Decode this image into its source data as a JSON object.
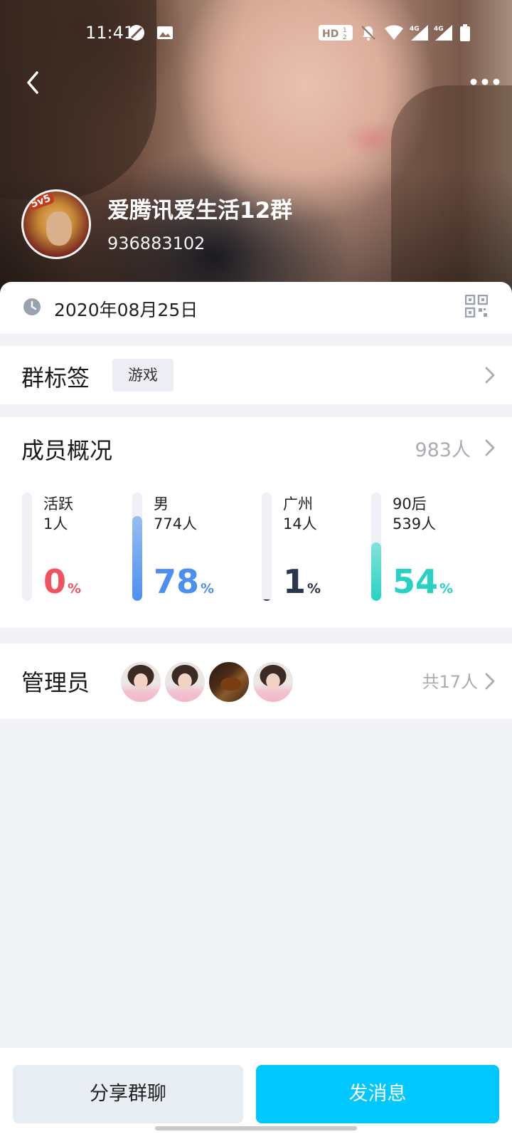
{
  "status_bar": {
    "time": "11:41",
    "icons": [
      "do-not-disturb-icon",
      "image-icon",
      "hd-voice-icon",
      "notifications-off-icon",
      "wifi-icon",
      "signal-4g-icon",
      "signal-4g-icon",
      "battery-icon"
    ],
    "network_label": "4G"
  },
  "nav": {
    "back_icon": "chevron-left-icon",
    "more_icon": "more-horizontal-icon"
  },
  "group": {
    "name": "爱腾讯爱生活12群",
    "id": "936883102",
    "avatar_badge": "5v5"
  },
  "info": {
    "created_date": "2020年08月25日"
  },
  "tags": {
    "title": "群标签",
    "items": [
      "游戏"
    ]
  },
  "members": {
    "title": "成员概况",
    "total": "983人",
    "stats": [
      {
        "label": "活跃",
        "count": "1人",
        "percent": 0,
        "percent_text": "0",
        "color": "#f0525f"
      },
      {
        "label": "男",
        "count": "774人",
        "percent": 78,
        "percent_text": "78",
        "color": "#4d8ff0"
      },
      {
        "label": "广州",
        "count": "14人",
        "percent": 1,
        "percent_text": "1",
        "color": "#2a3550"
      },
      {
        "label": "90后",
        "count": "539人",
        "percent": 54,
        "percent_text": "54",
        "color": "#26d3c3"
      }
    ],
    "percent_symbol": "%"
  },
  "admins": {
    "title": "管理员",
    "total": "共17人",
    "avatars": [
      "girl",
      "girl",
      "violin",
      "girl"
    ]
  },
  "actions": {
    "share_label": "分享群聊",
    "send_label": "发消息"
  },
  "colors": {
    "accent": "#00c8ff",
    "background": "#f2f3f7",
    "muted_text": "#a9acb3"
  }
}
